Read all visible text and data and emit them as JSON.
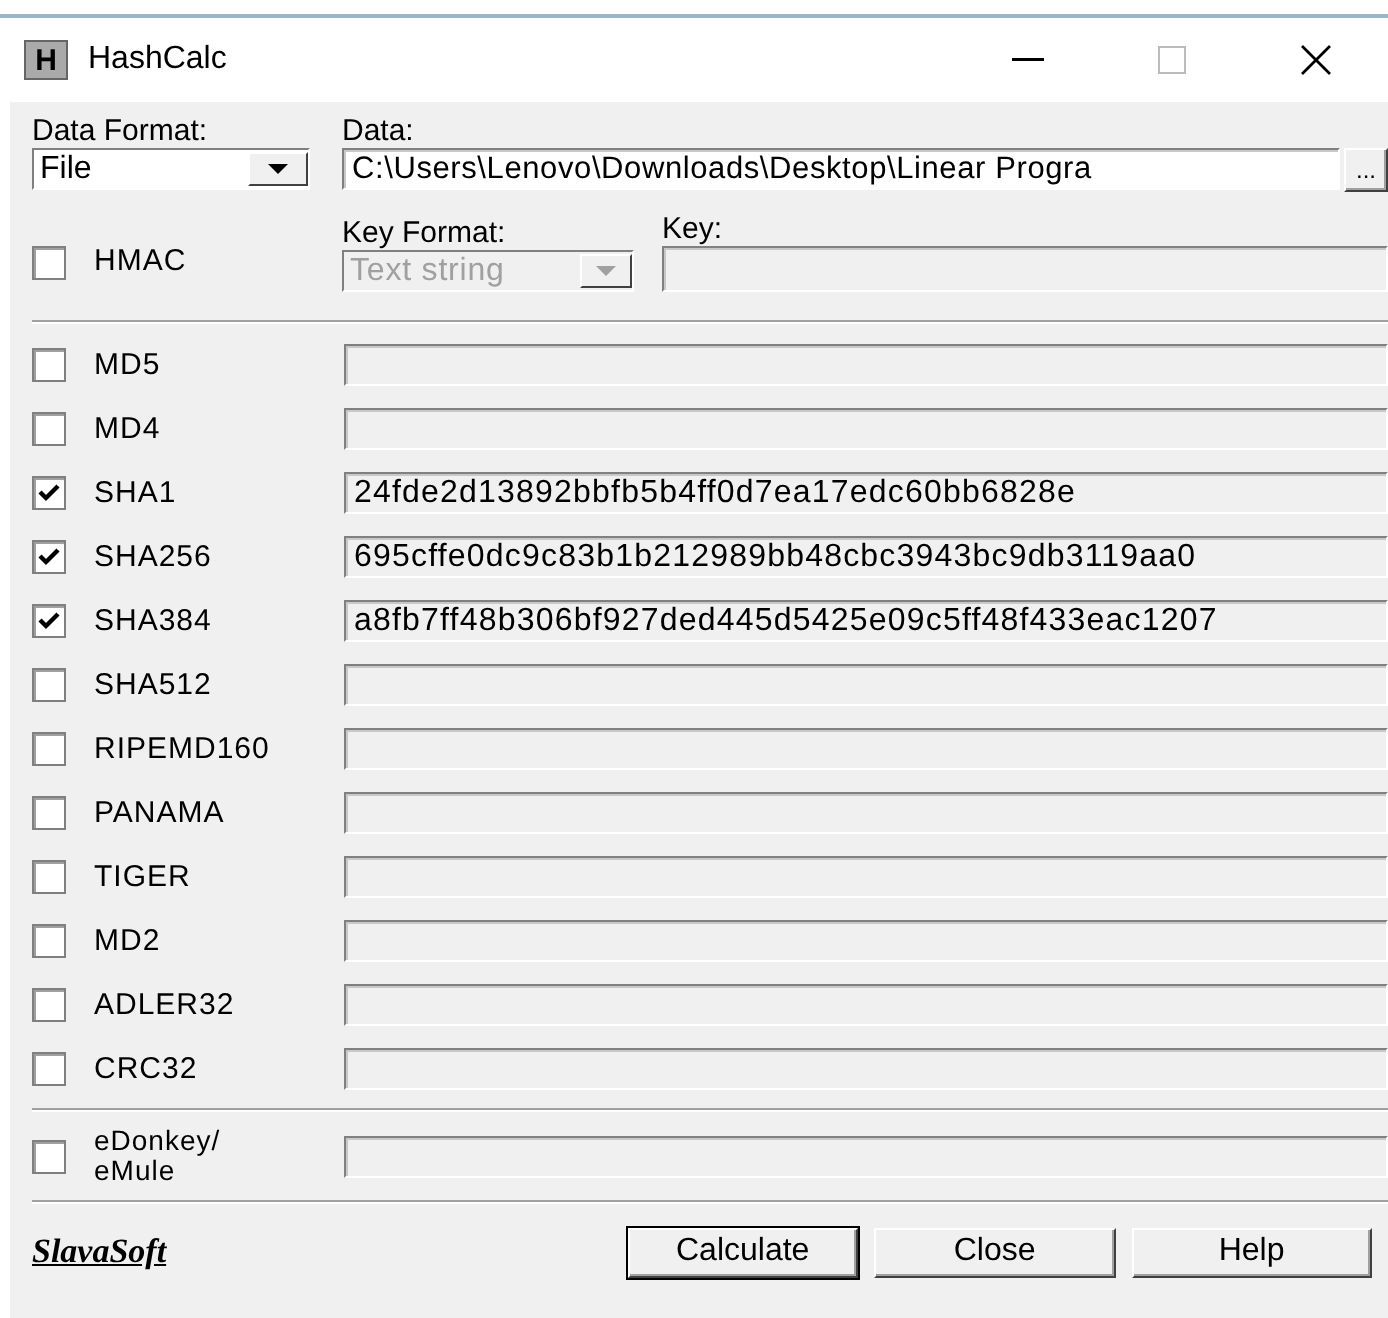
{
  "window": {
    "title": "HashCalc",
    "icon": "H"
  },
  "data_format": {
    "label": "Data Format:",
    "value": "File"
  },
  "data": {
    "label": "Data:",
    "value": "C:\\Users\\Lenovo\\Downloads\\Desktop\\Linear Progra",
    "browse": "..."
  },
  "hmac": {
    "label": "HMAC",
    "checked": false
  },
  "key_format": {
    "label": "Key Format:",
    "value": "Text string",
    "disabled": true
  },
  "key": {
    "label": "Key:",
    "disabled": true
  },
  "algorithms": [
    {
      "label": "MD5",
      "checked": false
    },
    {
      "label": "MD4",
      "checked": false
    },
    {
      "label": "SHA1",
      "checked": true,
      "value": "24fde2d13892bbfb5b4ff0d7ea17edc60bb6828e"
    },
    {
      "label": "SHA256",
      "checked": true,
      "value": "695cffe0dc9c83b1b212989bb48cbc3943bc9db3119aa0"
    },
    {
      "label": "SHA384",
      "checked": true,
      "value": "a8fb7ff48b306bf927ded445d5425e09c5ff48f433eac1207"
    },
    {
      "label": "SHA512",
      "checked": false
    },
    {
      "label": "RIPEMD160",
      "checked": false
    },
    {
      "label": "PANAMA",
      "checked": false
    },
    {
      "label": "TIGER",
      "checked": false
    },
    {
      "label": "MD2",
      "checked": false
    },
    {
      "label": "ADLER32",
      "checked": false
    },
    {
      "label": "CRC32",
      "checked": false
    }
  ],
  "more_algorithms": [
    {
      "label": "eDonkey/ eMule",
      "checked": false
    }
  ],
  "brand": "SlavaSoft",
  "buttons": [
    "Calculate",
    "Close",
    "Help"
  ]
}
